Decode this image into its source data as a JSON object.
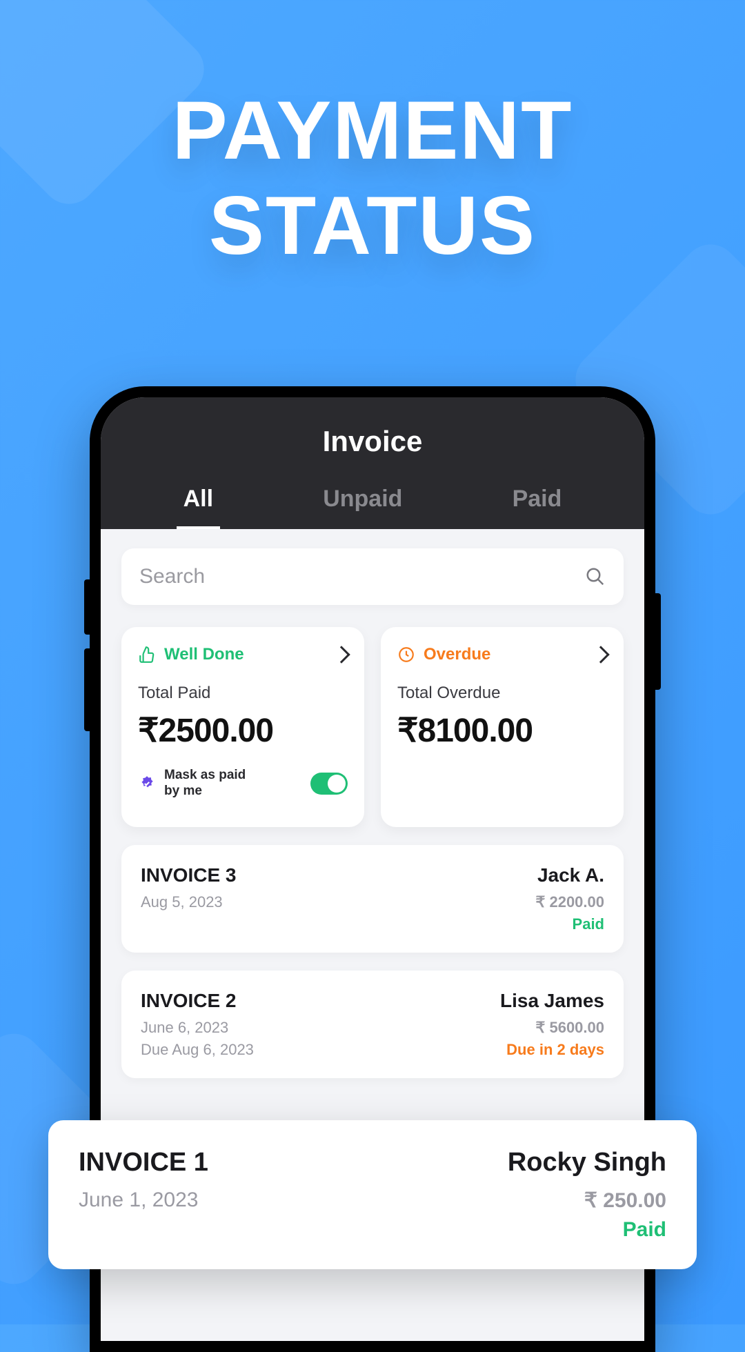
{
  "promo_title": "PAYMENT STATUS",
  "app": {
    "title": "Invoice"
  },
  "tabs": {
    "all": "All",
    "unpaid": "Unpaid",
    "paid": "Paid"
  },
  "search": {
    "placeholder": "Search"
  },
  "summary": {
    "paid": {
      "label": "Well Done",
      "subtitle": "Total Paid",
      "amount": "₹2500.00",
      "mask_label": "Mask as paid by me"
    },
    "overdue": {
      "label": "Overdue",
      "subtitle": "Total Overdue",
      "amount": "₹8100.00"
    }
  },
  "invoices": [
    {
      "title": "INVOICE 3",
      "name": "Jack A.",
      "date": "Aug 5, 2023",
      "amount": "₹ 2200.00",
      "status": "Paid",
      "due": ""
    },
    {
      "title": "INVOICE 2",
      "name": "Lisa James",
      "date": "June 6, 2023",
      "amount": "₹ 5600.00",
      "status": "Due in 2 days",
      "due": "Due Aug 6, 2023"
    }
  ],
  "floating": {
    "title": "INVOICE 1",
    "name": "Rocky Singh",
    "date": "June 1, 2023",
    "amount": "₹ 250.00",
    "status": "Paid"
  },
  "colors": {
    "bg_blue": "#3b9aff",
    "green": "#1fbf75",
    "orange": "#f77b1c",
    "dark": "#2a2a2e"
  }
}
